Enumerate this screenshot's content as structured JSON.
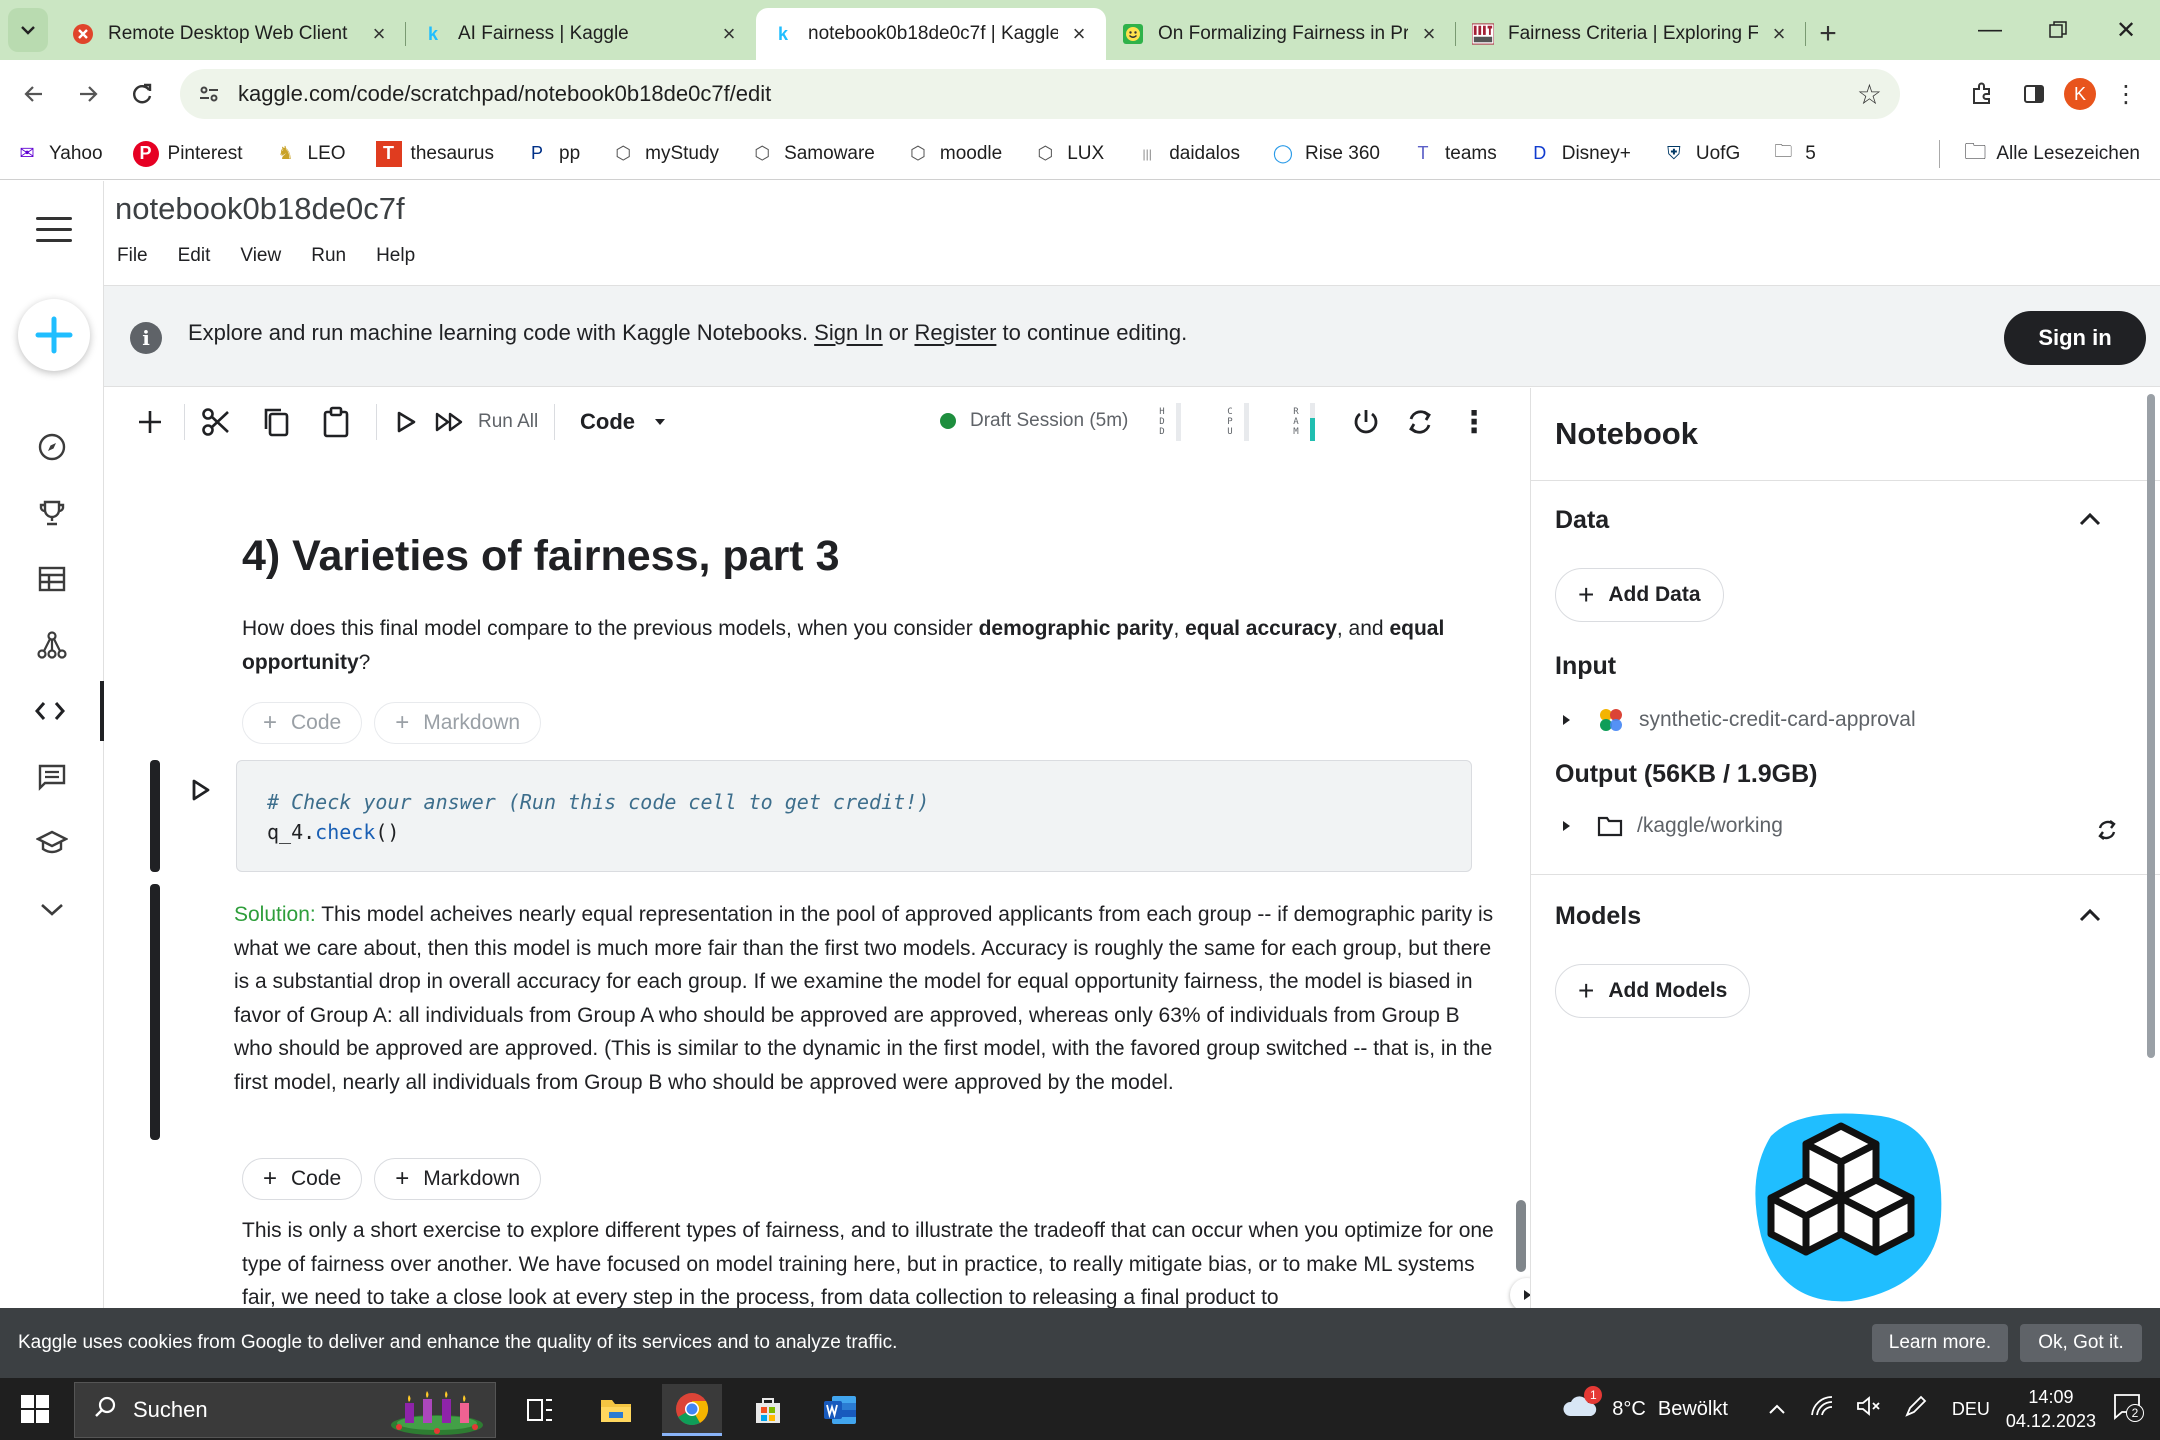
{
  "browser": {
    "tabs": [
      {
        "title": "Remote Desktop Web Client",
        "icon": "remote-desktop-icon",
        "active": false
      },
      {
        "title": "AI Fairness | Kaggle",
        "icon": "kaggle-k-icon",
        "active": false
      },
      {
        "title": "notebook0b18de0c7f | Kaggle",
        "icon": "kaggle-k-icon",
        "active": true
      },
      {
        "title": "On Formalizing Fairness in Pred",
        "icon": "smiley-icon",
        "active": false
      },
      {
        "title": "Fairness Criteria | Exploring Fair",
        "icon": "mit-icon",
        "active": false
      }
    ],
    "url": "kaggle.com/code/scratchpad/notebook0b18de0c7f/edit",
    "profile_initial": "K",
    "bookmarks": [
      {
        "label": "Yahoo",
        "icon": "mail-icon",
        "color": "#6001d2"
      },
      {
        "label": "Pinterest",
        "icon": "pinterest-icon",
        "color": "#e60023"
      },
      {
        "label": "LEO",
        "icon": "leo-icon",
        "color": "#c9a227"
      },
      {
        "label": "thesaurus",
        "icon": "thesaurus-icon",
        "color": "#e03c1f"
      },
      {
        "label": "pp",
        "icon": "paypal-icon",
        "color": "#003087"
      },
      {
        "label": "myStudy",
        "icon": "cube-icon",
        "color": "#555555"
      },
      {
        "label": "Samoware",
        "icon": "cube-icon",
        "color": "#555555"
      },
      {
        "label": "moodle",
        "icon": "cube-icon",
        "color": "#555555"
      },
      {
        "label": "LUX",
        "icon": "cube-icon",
        "color": "#555555"
      },
      {
        "label": "daidalos",
        "icon": "bars-icon",
        "color": "#888888"
      },
      {
        "label": "Rise 360",
        "icon": "ring-icon",
        "color": "#2b9be8"
      },
      {
        "label": "teams",
        "icon": "teams-icon",
        "color": "#5b5fc7"
      },
      {
        "label": "Disney+",
        "icon": "disney-icon",
        "color": "#113ccf"
      },
      {
        "label": "UofG",
        "icon": "shield-icon",
        "color": "#003865"
      },
      {
        "label": "5",
        "icon": "folder-icon",
        "color": "#333333"
      }
    ],
    "all_bookmarks": "Alle Lesezeichen"
  },
  "notebook": {
    "title": "notebook0b18de0c7f",
    "menu": [
      "File",
      "Edit",
      "View",
      "Run",
      "Help"
    ],
    "banner": {
      "text_before": "Explore and run machine learning code with Kaggle Notebooks. ",
      "sign_in_link": "Sign In",
      "or": " or ",
      "register_link": "Register",
      "text_after": " to continue editing.",
      "button": "Sign in"
    },
    "toolbar": {
      "run_all": "Run All",
      "cell_type": "Code",
      "session": "Draft Session (5m)",
      "meters": [
        {
          "label": "HDD",
          "fill": 0.0
        },
        {
          "label": "CPU",
          "fill": 0.0
        },
        {
          "label": "RAM",
          "fill": 0.6
        }
      ]
    },
    "heading": "4) Varieties of fairness, part 3",
    "question": {
      "p1": "How does this final model compare to the previous models, when you consider ",
      "b1": "demographic parity",
      "p2": ", ",
      "b2": "equal accuracy",
      "p3": ", and ",
      "b3": "equal opportunity",
      "p4": "?"
    },
    "add_code": "Code",
    "add_markdown": "Markdown",
    "code_comment": "# Check your answer (Run this code cell to get credit!)",
    "code_obj": "q_4",
    "code_dot": ".",
    "code_fn": "check",
    "code_parens": "()",
    "solution_label": "Solution:",
    "solution_text": " This model acheives nearly equal representation in the pool of approved applicants from each group -- if demographic parity is what we care about, then this model is much more fair than the first two models. Accuracy is roughly the same for each group, but there is a substantial drop in overall accuracy for each group. If we examine the model for equal opportunity fairness, the model is biased in favor of Group A: all individuals from Group A who should be approved are approved, whereas only 63% of individuals from Group B who should be approved are approved. (This is similar to the dynamic in the first model, with the favored group switched -- that is, in the first model, nearly all individuals from Group B who should be approved were approved by the model.",
    "closing_text": "This is only a short exercise to explore different types of fairness, and to illustrate the tradeoff that can occur when you optimize for one type of fairness over another. We have focused on model training here, but in practice, to really mitigate bias, or to make ML systems fair, we need to take a close look at every step in the process, from data collection to releasing a final product to"
  },
  "panel": {
    "title": "Notebook",
    "data_section": "Data",
    "add_data": "Add Data",
    "input_label": "Input",
    "input_item": "synthetic-credit-card-approval",
    "output_label": "Output (56KB / 1.9GB)",
    "output_item": "/kaggle/working",
    "models_section": "Models",
    "add_models": "Add Models"
  },
  "cookie": {
    "text": "Kaggle uses cookies from Google to deliver and enhance the quality of its services and to analyze traffic.",
    "learn_more": "Learn more.",
    "ok": "Ok, Got it."
  },
  "taskbar": {
    "search": "Suchen",
    "weather": "8°C",
    "weather_desc": "Bewölkt",
    "weather_badge": "1",
    "lang": "DEU",
    "time": "14:09",
    "date": "04.12.2023",
    "notif_count": "2"
  }
}
